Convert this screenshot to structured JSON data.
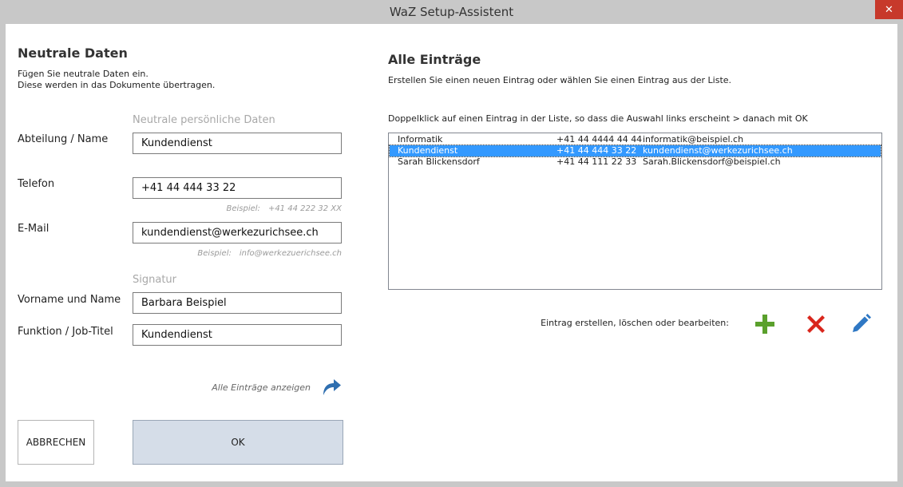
{
  "window": {
    "title": "WaZ Setup-Assistent",
    "close_glyph": "✕"
  },
  "left": {
    "heading": "Neutrale Daten",
    "intro_line1": "Fügen Sie neutrale Daten ein.",
    "intro_line2": "Diese werden in das Dokumente übertragen.",
    "group_personal": "Neutrale persönliche Daten",
    "group_signature": "Signatur",
    "fields": {
      "department": {
        "label": "Abteilung / Name",
        "value": "Kundendienst"
      },
      "phone": {
        "label": "Telefon",
        "value": "+41 44 444 33 22",
        "hint_label": "Beispiel:",
        "hint_value": "+41 44 222 32 XX"
      },
      "email": {
        "label": "E-Mail",
        "value": "kundendienst@werkezurichsee.ch",
        "hint_label": "Beispiel:",
        "hint_value": "info@werkezuerichsee.ch"
      },
      "fullname": {
        "label": "Vorname und Name",
        "value": "Barbara Beispiel"
      },
      "jobtitle": {
        "label": "Funktion / Job-Titel",
        "value": "Kundendienst"
      }
    },
    "show_all_label": "Alle Einträge anzeigen",
    "cancel_label": "ABBRECHEN",
    "ok_label": "OK"
  },
  "right": {
    "heading": "Alle Einträge",
    "intro": "Erstellen Sie einen neuen Eintrag oder wählen Sie einen Eintrag aus der Liste.",
    "instruction": "Doppelklick auf einen Eintrag in der Liste, so dass die Auswahl links erscheint > danach mit OK",
    "entries": [
      {
        "name": "Informatik",
        "phone": "+41 44 4444 44 44",
        "email": "informatik@beispiel.ch"
      },
      {
        "name": "Kundendienst",
        "phone": "+41 44 444 33 22",
        "email": "kundendienst@werkezurichsee.ch"
      },
      {
        "name": "Sarah Blickensdorf",
        "phone": "+41 44 111 22 33",
        "email": "Sarah.Blickensdorf@beispiel.ch"
      }
    ],
    "selected_index": 1,
    "actions_label": "Eintrag erstellen, löschen oder bearbeiten:",
    "icons": {
      "add": "plus-icon",
      "delete": "x-icon",
      "edit": "pencil-icon",
      "show_all": "arrow-forward-icon"
    },
    "colors": {
      "add": "#5aa02c",
      "delete": "#d9261c",
      "edit": "#2f78c4",
      "selection": "#3399ff",
      "ok_button": "#d5dde8"
    }
  }
}
